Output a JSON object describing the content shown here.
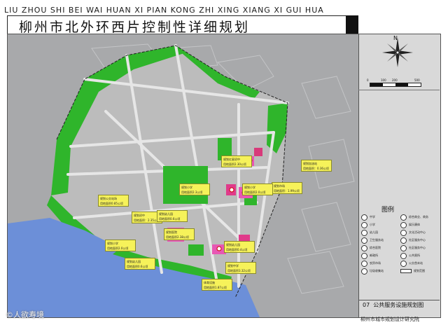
{
  "header": {
    "pinyin_title": "LIU ZHOU SHI BEI WAI HUAN XI PIAN KONG ZHI XING XIANG XI GUI HUA",
    "title": "柳州市北外环西片控制性详细规划"
  },
  "compass": {
    "north_label": "N"
  },
  "scale": {
    "ticks": [
      "0",
      "100",
      "200",
      "500"
    ]
  },
  "legend": {
    "title": "图例",
    "items": [
      {
        "label": "中学"
      },
      {
        "label": "综合商业、商务"
      },
      {
        "label": "小学"
      },
      {
        "label": "娱乐康体"
      },
      {
        "label": "幼儿园"
      },
      {
        "label": "文化活动中心"
      },
      {
        "label": "卫生服务站"
      },
      {
        "label": "社区服务中心"
      },
      {
        "label": "综合医院"
      },
      {
        "label": "社区服务中心"
      },
      {
        "label": "邮政所"
      },
      {
        "label": "公共厕所"
      },
      {
        "label": "农贸市场"
      },
      {
        "label": "公交首末站"
      },
      {
        "label": "垃圾收集站"
      },
      {
        "label": "规划范围"
      }
    ]
  },
  "caption": {
    "number": "07",
    "title": "公共服务设施规划图"
  },
  "institute": "柳州市城市规划设计研究院",
  "watermark": "©人欲寿境",
  "callouts": [
    {
      "line1": "规划红星初中",
      "line2": "用地面积2.30公顷"
    },
    {
      "line1": "规划小学",
      "line2": "用地面积2.3公顷"
    },
    {
      "line1": "规划公交站场",
      "line2": "用地面积0.85公顷"
    },
    {
      "line1": "规划初中",
      "line2": "用地面积：2.35公顷"
    },
    {
      "line1": "规划加油站",
      "line2": "用地面积：0.36公顷"
    },
    {
      "line1": "规划市场",
      "line2": "用地面积：1.99公顷"
    },
    {
      "line1": "规划小学",
      "line2": "用地面积2.0公顷"
    },
    {
      "line1": "规划幼儿园",
      "line2": "用地面积0.6公顷"
    },
    {
      "line1": "规划医院",
      "line2": "用地面积2.38公顷"
    },
    {
      "line1": "规划小学",
      "line2": "用地面积2.0公顷"
    },
    {
      "line1": "规划幼儿园",
      "line2": "用地面积0.6公顷"
    },
    {
      "line1": "规划幼儿园",
      "line2": "用地面积0.4公顷"
    },
    {
      "line1": "规划中学",
      "line2": "用地面积3.32公顷"
    },
    {
      "line1": "体育设施",
      "line2": "用地面积1.87公顷"
    }
  ],
  "colors": {
    "green_space": "#2fb52b",
    "water": "#6c8fd8",
    "public_facility": "#e857b4",
    "landuse_gray": "#bdbdbd",
    "callout_yellow": "#f6f25a",
    "road": "#e6e6e6"
  }
}
